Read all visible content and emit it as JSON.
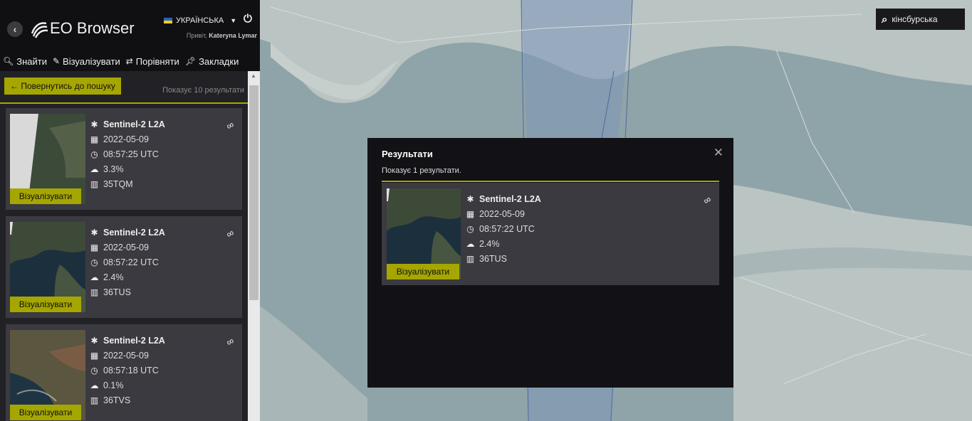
{
  "app": {
    "title": "EO Browser",
    "language": "УКРАЇНСЬКА",
    "greeting_prefix": "Привіт,",
    "user_name": "Kateryna Lymar"
  },
  "tabs": [
    {
      "label": "Знайти",
      "icon": "search-icon"
    },
    {
      "label": "Візуалізувати",
      "icon": "brush-icon"
    },
    {
      "label": "Порівняти",
      "icon": "compare-icon"
    },
    {
      "label": "Закладки",
      "icon": "pin-icon"
    }
  ],
  "toolbar": {
    "back_label": "← Повернутись до пошуку",
    "showing_text": "Показує 10 результати"
  },
  "results": [
    {
      "title": "Sentinel-2 L2A",
      "date": "2022-05-09",
      "time": "08:57:25 UTC",
      "cloud": "3.3%",
      "tile": "35TQM",
      "button": "Візуалізувати"
    },
    {
      "title": "Sentinel-2 L2A",
      "date": "2022-05-09",
      "time": "08:57:22 UTC",
      "cloud": "2.4%",
      "tile": "36TUS",
      "button": "Візуалізувати"
    },
    {
      "title": "Sentinel-2 L2A",
      "date": "2022-05-09",
      "time": "08:57:18 UTC",
      "cloud": "0.1%",
      "tile": "36TVS",
      "button": "Візуалізувати"
    }
  ],
  "map_search": {
    "value": "кінсбурська"
  },
  "modal": {
    "title": "Результати",
    "subtitle": "Показує 1 результати.",
    "close": "✕",
    "result": {
      "title": "Sentinel-2 L2A",
      "date": "2022-05-09",
      "time": "08:57:22 UTC",
      "cloud": "2.4%",
      "tile": "36TUS",
      "button": "Візуалізувати"
    }
  },
  "colors": {
    "accent": "#a6a600",
    "panel": "#222226",
    "card": "#3a3a40",
    "header": "#101013",
    "map_water": "#8fa4a8",
    "map_land": "#b9c4c3",
    "footprint": "#7d95b8"
  }
}
